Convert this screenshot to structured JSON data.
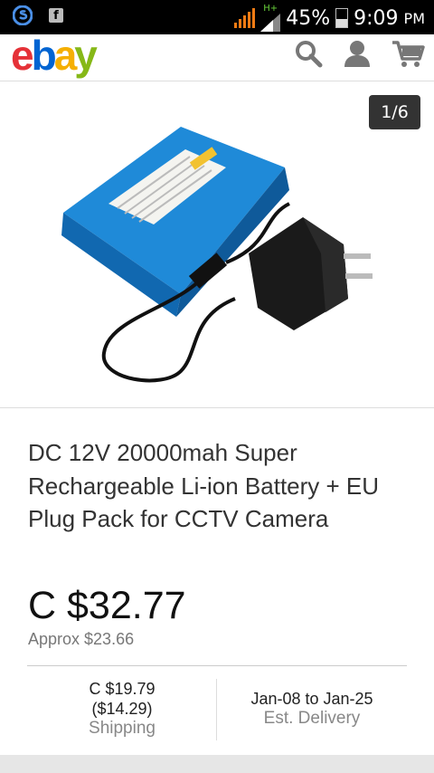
{
  "status_bar": {
    "battery_percent": "45%",
    "time": "9:09",
    "ampm": "PM",
    "network": "H+",
    "icons": [
      "skype-icon",
      "facebook-icon",
      "signal-icon",
      "battery-icon"
    ]
  },
  "header": {
    "logo": "ebay",
    "icons": [
      "search-icon",
      "user-icon",
      "cart-icon"
    ]
  },
  "gallery": {
    "counter": "1/6"
  },
  "product": {
    "title": "DC 12V 20000mah Super Rechargeable Li-ion Battery + EU Plug Pack for CCTV Camera",
    "price": "C $32.77",
    "approx": "Approx $23.66"
  },
  "shipping": {
    "price": "C $19.79",
    "approx": "($14.29)",
    "label": "Shipping"
  },
  "delivery": {
    "range": "Jan-08 to Jan-25",
    "label": "Est. Delivery"
  },
  "colors": {
    "ebay_red": "#e53238",
    "ebay_blue": "#0064d2",
    "ebay_yellow": "#f5af02",
    "ebay_green": "#86b817",
    "signal": "#f07b14"
  }
}
